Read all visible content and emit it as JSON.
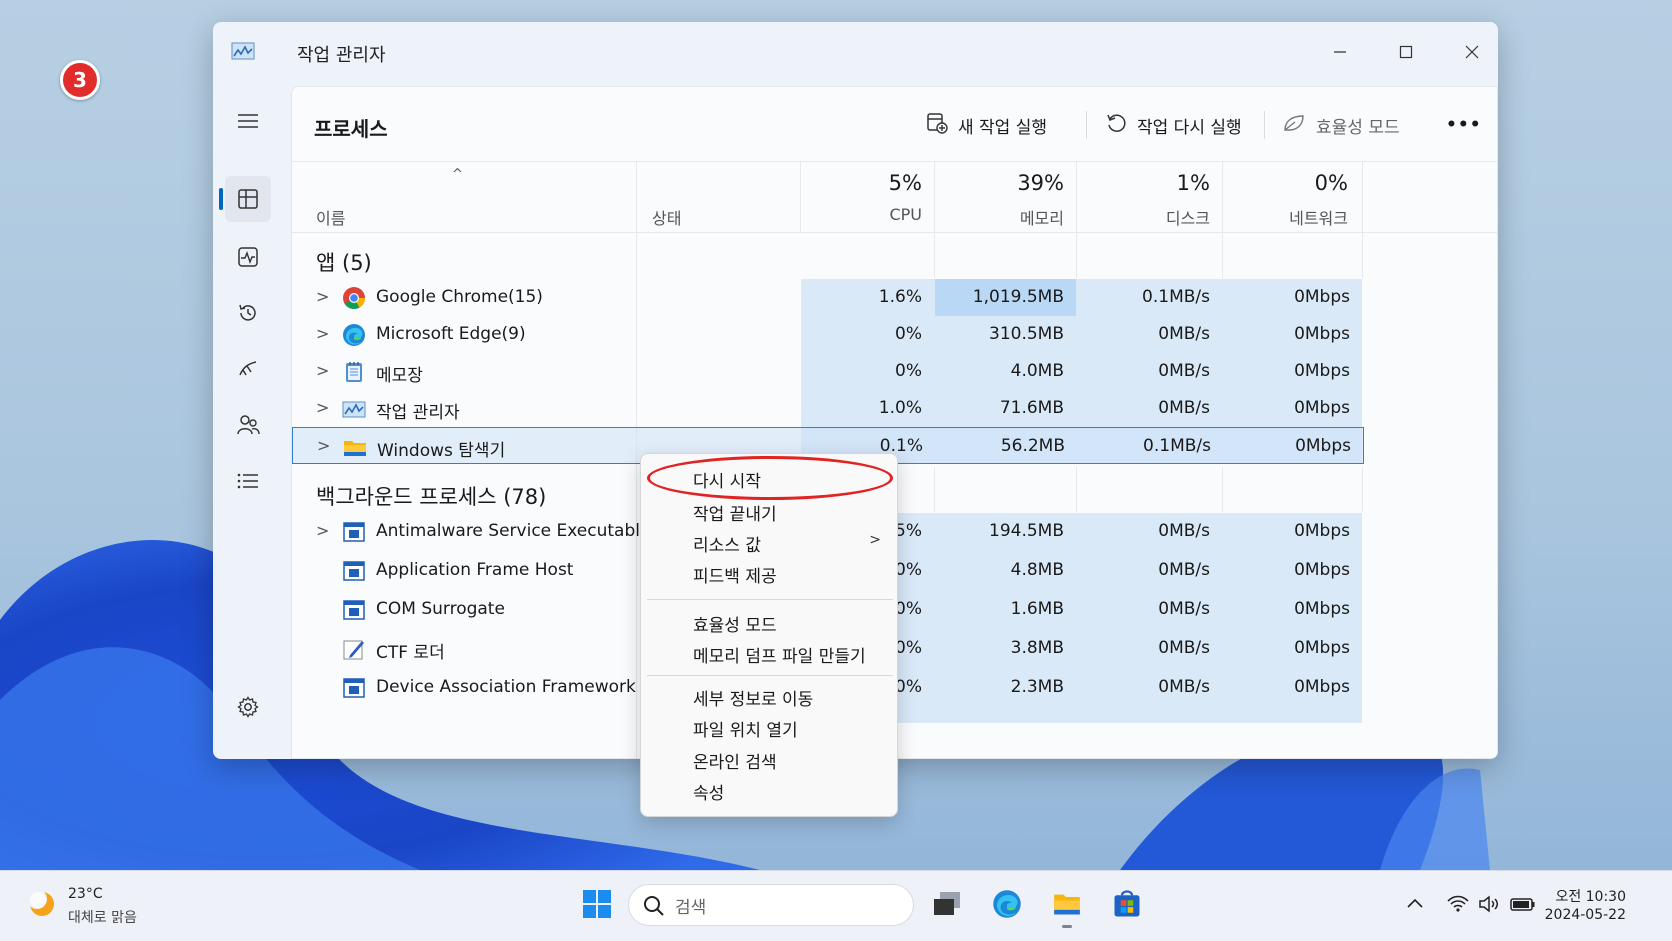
{
  "step_badge": "3",
  "window": {
    "title": "작업 관리자"
  },
  "page": {
    "title": "프로세스"
  },
  "toolbar": {
    "new_task": "새 작업 실행",
    "restart_task": "작업 다시 실행",
    "efficiency_mode": "효율성 모드",
    "more": "•••"
  },
  "columns": {
    "name": "이름",
    "status": "상태",
    "cpu_pct": "5%",
    "cpu": "CPU",
    "mem_pct": "39%",
    "mem": "메모리",
    "disk_pct": "1%",
    "disk": "디스크",
    "net_pct": "0%",
    "net": "네트워크"
  },
  "groups": {
    "apps": "앱 (5)",
    "background": "백그라운드 프로세스 (78)"
  },
  "apps": [
    {
      "name": "Google Chrome(15)",
      "icon": "chrome-icon",
      "cpu": "1.6%",
      "mem": "1,019.5MB",
      "disk": "0.1MB/s",
      "net": "0Mbps"
    },
    {
      "name": "Microsoft Edge(9)",
      "icon": "edge-icon",
      "cpu": "0%",
      "mem": "310.5MB",
      "disk": "0MB/s",
      "net": "0Mbps"
    },
    {
      "name": "메모장",
      "icon": "notepad-icon",
      "cpu": "0%",
      "mem": "4.0MB",
      "disk": "0MB/s",
      "net": "0Mbps"
    },
    {
      "name": "작업 관리자",
      "icon": "task-manager-icon",
      "cpu": "1.0%",
      "mem": "71.6MB",
      "disk": "0MB/s",
      "net": "0Mbps"
    },
    {
      "name": "Windows 탐색기",
      "icon": "folder-icon",
      "cpu": "0.1%",
      "mem": "56.2MB",
      "disk": "0.1MB/s",
      "net": "0Mbps"
    }
  ],
  "background": [
    {
      "name": "Antimalware Service Executable",
      "icon": "service-icon",
      "cpu": "0.5%",
      "mem": "194.5MB",
      "disk": "0MB/s",
      "net": "0Mbps"
    },
    {
      "name": "Application Frame Host",
      "icon": "service-icon",
      "cpu": "0%",
      "mem": "4.8MB",
      "disk": "0MB/s",
      "net": "0Mbps"
    },
    {
      "name": "COM Surrogate",
      "icon": "service-icon",
      "cpu": "0%",
      "mem": "1.6MB",
      "disk": "0MB/s",
      "net": "0Mbps"
    },
    {
      "name": "CTF 로더",
      "icon": "pen-icon",
      "cpu": "0%",
      "mem": "3.8MB",
      "disk": "0MB/s",
      "net": "0Mbps"
    },
    {
      "name": "Device Association Framework ...",
      "icon": "service-icon",
      "cpu": "0%",
      "mem": "2.3MB",
      "disk": "0MB/s",
      "net": "0Mbps"
    }
  ],
  "context_menu": {
    "restart": "다시 시작",
    "end_task": "작업 끝내기",
    "resource_values": "리소스 값",
    "feedback": "피드백 제공",
    "efficiency_mode": "효율성 모드",
    "create_dump": "메모리 덤프 파일 만들기",
    "go_to_details": "세부 정보로 이동",
    "open_file_location": "파일 위치 열기",
    "search_online": "온라인 검색",
    "properties": "속성"
  },
  "taskbar": {
    "weather_temp": "23°C",
    "weather_desc": "대체로 맑음",
    "search_placeholder": "검색",
    "time": "오전 10:30",
    "date": "2024-05-22"
  },
  "colors": {
    "accent": "#0067c0",
    "highlight_ring": "#e02424",
    "heat": "#d9e9f8",
    "heat_strong": "#b8d8f5"
  }
}
